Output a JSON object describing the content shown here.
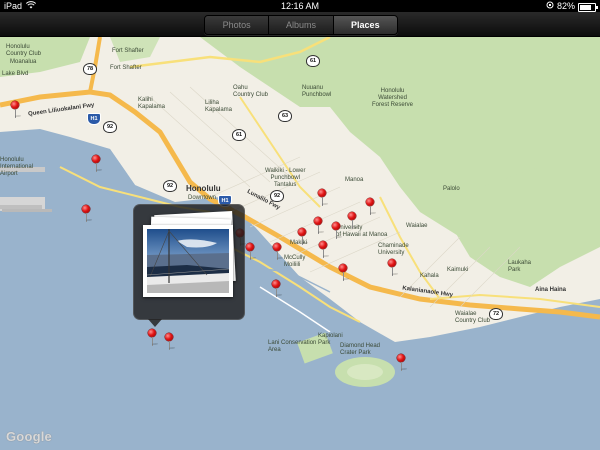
{
  "status_bar": {
    "device": "iPad",
    "time": "12:16 AM",
    "battery": "82%",
    "battery_level": 0.82,
    "wifi_icon": "wifi-icon",
    "lock_icon": "orientation-lock-icon"
  },
  "toolbar": {
    "tabs": [
      {
        "label": "Photos",
        "active": false
      },
      {
        "label": "Albums",
        "active": false
      },
      {
        "label": "Places",
        "active": true
      }
    ]
  },
  "map": {
    "labels": {
      "honolulu_cc": "Honolulu\nCountry Club",
      "fort_shafter": "Fort Shafter",
      "fort_shafter2": "Fort Shafter",
      "moanalua": "Moanalua",
      "salt_lake_blvd": "Lake Blvd",
      "honolulu_nwr": "Honolulu\nWatershed\nForest Reserve",
      "nuuanu_punchbowl": "Nuuanu\nPunchbowl",
      "oahu_cc": "Oahu\nCountry Club",
      "lililha_kapalama": "Liliha\nKapalama",
      "kalihi": "Kalihi\nKapalama",
      "queen_liliuokalani": "Queen Liliuokalani Fwy",
      "airport": "Honolulu\nInternational\nAirport",
      "downtown": "Downtown",
      "honolulu": "Honolulu",
      "waikiki_lower": "Waikiki - Lower\nPunchbowl\nTantalus",
      "manoa": "Manoa",
      "makiki": "Makiki",
      "mccully": "McCully\nMoiliili",
      "univ_hawaii": "University\nof Hawaii at Manoa",
      "chaminade": "Chaminade\nUniversity",
      "palolo": "Palolo",
      "waialae": "Waialae",
      "kahala": "Kahala",
      "kaimuki": "Kaimuki",
      "laukaha": "Laukaha\nPark",
      "waialae_cc": "Waialae\nCountry Club",
      "aina_haina": "Aina Haina",
      "diamond_head": "Diamond Head\nCrater Park",
      "kapiolani": "Kapiolani\nPark",
      "diamond_head_conservation": "Lani Conservation\nArea",
      "h1": "H1",
      "kalanianaole": "Kalanianaole Hwy",
      "lunalilo": "Lunalilo Fwy",
      "manoa_label": "Manoa"
    },
    "shields": [
      "78",
      "92",
      "61",
      "63",
      "61",
      "92",
      "92",
      "H1",
      "72",
      "H1"
    ]
  },
  "popup": {
    "photo_subject": "sailboat-photo"
  },
  "google_logo": "Google"
}
